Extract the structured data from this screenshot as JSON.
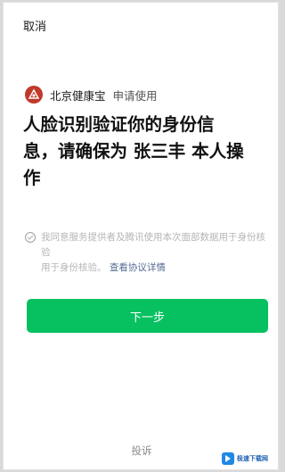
{
  "header": {
    "cancel_label": "取消"
  },
  "app": {
    "logo_icon": "health-treasure-logo-icon",
    "brand_color": "#c0392b",
    "name": "北京健康宝",
    "action": "申请使用"
  },
  "main": {
    "title_line1": "人脸识别验证你的身份信",
    "title_line2": "息，请确保为 张三丰 本人操",
    "title_line3": "作"
  },
  "agreement": {
    "text_line1": "我同意服务提供者及腾讯使用本次面部数据用于身份核验",
    "text_line2": "用于身份核验。",
    "link_label": "查看协议详情",
    "checked": false
  },
  "primary": {
    "next_label": "下一步",
    "color": "#07c160"
  },
  "footer": {
    "feedback_label": "投诉"
  },
  "watermark": {
    "text": "极速下载网"
  }
}
